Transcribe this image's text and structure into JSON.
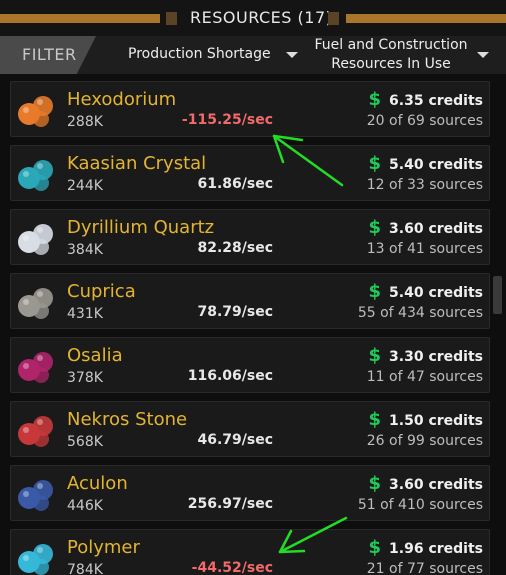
{
  "header": {
    "title": "RESOURCES (17)"
  },
  "filter_bar": {
    "filter_label": "FILTER",
    "dropdown1": "Production Shortage",
    "dropdown2_line1": "Fuel and Construction",
    "dropdown2_line2": "Resources In Use"
  },
  "resources": [
    {
      "name": "Hexodorium",
      "amount": "288K",
      "rate": "-115.25/sec",
      "credits": "6.35 credits",
      "sources": "20 of 69 sources",
      "icon": "orange-ore-icon",
      "color": "#e87a2a"
    },
    {
      "name": "Kaasian Crystal",
      "amount": "244K",
      "rate": "61.86/sec",
      "credits": "5.40 credits",
      "sources": "12 of 33 sources",
      "icon": "teal-crystal-icon",
      "color": "#2aa8b8"
    },
    {
      "name": "Dyrillium Quartz",
      "amount": "384K",
      "rate": "82.28/sec",
      "credits": "3.60 credits",
      "sources": "13 of 41 sources",
      "icon": "white-quartz-icon",
      "color": "#d8dde6"
    },
    {
      "name": "Cuprica",
      "amount": "431K",
      "rate": "78.79/sec",
      "credits": "5.40 credits",
      "sources": "55 of 434 sources",
      "icon": "grey-rock-icon",
      "color": "#9a9890"
    },
    {
      "name": "Osalia",
      "amount": "378K",
      "rate": "116.06/sec",
      "credits": "3.30 credits",
      "sources": "11 of 47 sources",
      "icon": "purple-crystal-icon",
      "color": "#b0246a"
    },
    {
      "name": "Nekros Stone",
      "amount": "568K",
      "rate": "46.79/sec",
      "credits": "1.50 credits",
      "sources": "26 of 99 sources",
      "icon": "red-stone-icon",
      "color": "#c8383a"
    },
    {
      "name": "Aculon",
      "amount": "446K",
      "rate": "256.97/sec",
      "credits": "3.60 credits",
      "sources": "51 of 410 sources",
      "icon": "blue-orbs-icon",
      "color": "#3a5aa8"
    },
    {
      "name": "Polymer",
      "amount": "784K",
      "rate": "-44.52/sec",
      "credits": "1.96 credits",
      "sources": "21 of 77 sources",
      "icon": "cyan-spheres-icon",
      "color": "#36b8d8"
    }
  ],
  "colors": {
    "accent_gold": "#e3b431",
    "credit_green": "#22c85a",
    "negative_red": "#f26a6a",
    "annotation_arrow": "#22dd22"
  }
}
